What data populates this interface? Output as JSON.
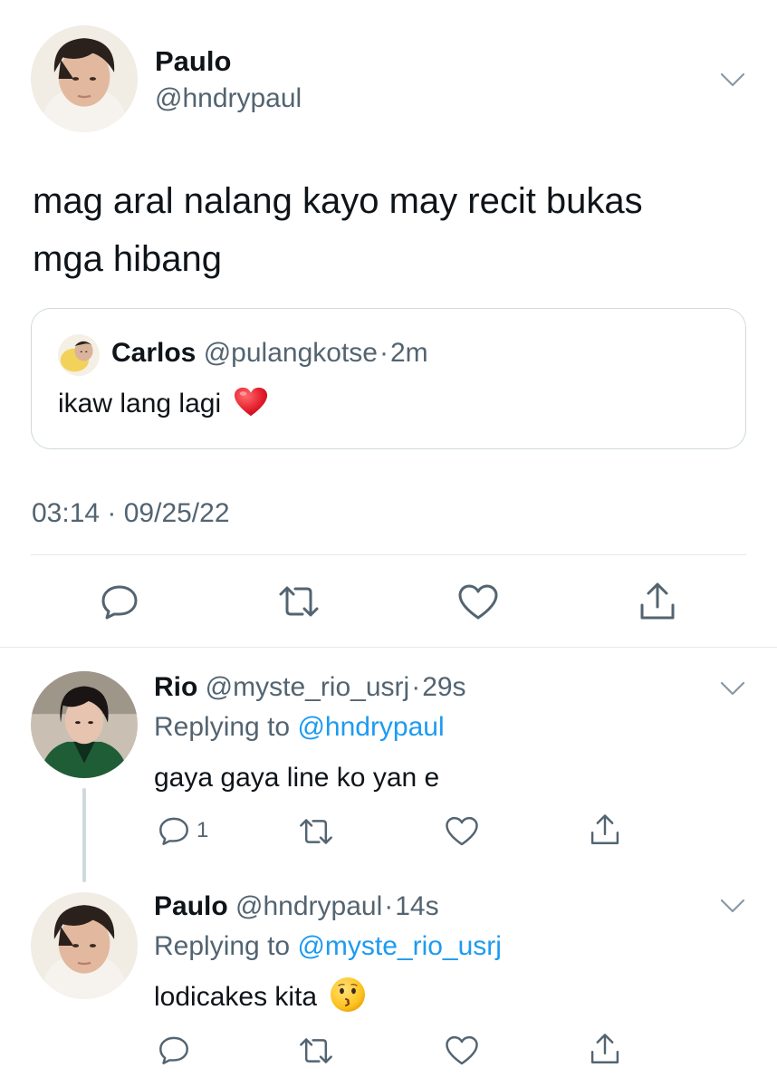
{
  "main_tweet": {
    "author_name": "Paulo",
    "author_handle": "@hndrypaul",
    "text_line1": "mag aral nalang kayo may recit bukas",
    "text_line2": "mga hibang",
    "quoted": {
      "author_name": "Carlos",
      "author_handle": "@pulangkotse",
      "sep": "·",
      "time": "2m",
      "text": "ikaw lang lagi"
    },
    "timestamp": "03:14 · 09/25/22",
    "actions": [
      "reply-icon",
      "retweet-icon",
      "like-icon",
      "share-icon"
    ]
  },
  "replies": [
    {
      "author_name": "Rio",
      "author_handle": "@myste_rio_usrj",
      "sep": "·",
      "time": "29s",
      "replying_prefix": "Replying to",
      "replying_to": "@hndrypaul",
      "text": "gaya gaya line ko yan e",
      "reply_count": "1"
    },
    {
      "author_name": "Paulo",
      "author_handle": "@hndrypaul",
      "sep": "·",
      "time": "14s",
      "replying_prefix": "Replying to",
      "replying_to": "@myste_rio_usrj",
      "text": "lodicakes kita",
      "reply_count": ""
    }
  ],
  "colors": {
    "text": "#0f1419",
    "secondary": "#536471",
    "link": "#1d9bf0",
    "border": "#cfd9de",
    "heart": "#e0245e"
  }
}
